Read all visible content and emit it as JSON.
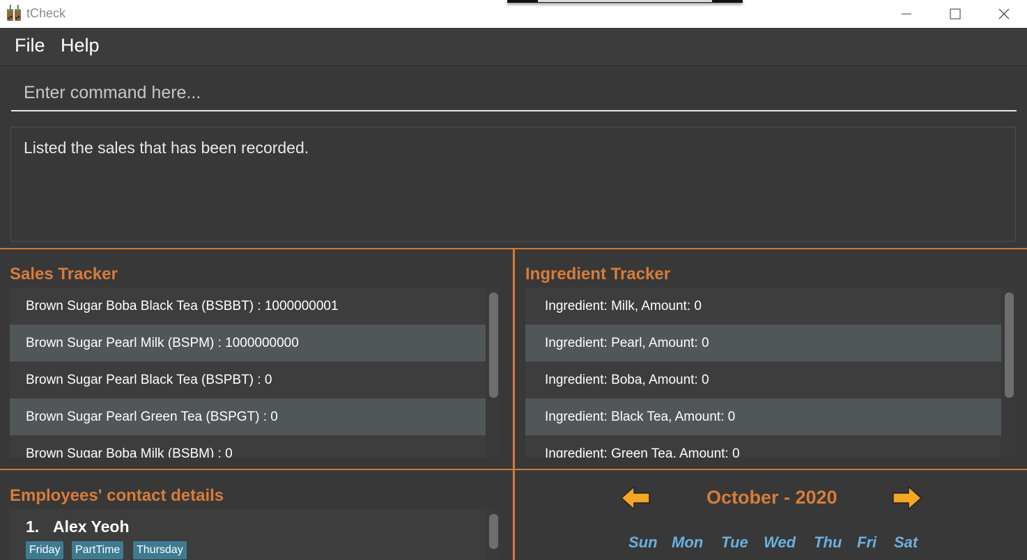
{
  "window": {
    "title": "tCheck"
  },
  "menu": {
    "file": "File",
    "help": "Help"
  },
  "command": {
    "placeholder": "Enter command here..."
  },
  "result": {
    "text": "Listed the sales that has been recorded."
  },
  "sales": {
    "title": "Sales Tracker",
    "items": [
      "Brown Sugar Boba Black Tea (BSBBT) : 1000000001",
      "Brown Sugar Pearl Milk (BSPM) : 1000000000",
      "Brown Sugar Pearl Black Tea (BSPBT) : 0",
      "Brown Sugar Pearl Green Tea (BSPGT) : 0",
      "Brown Sugar Boba Milk (BSBM) : 0"
    ]
  },
  "ingredients": {
    "title": "Ingredient Tracker",
    "items": [
      "Ingredient: Milk,  Amount: 0",
      "Ingredient: Pearl,  Amount: 0",
      "Ingredient: Boba,  Amount: 0",
      "Ingredient: Black Tea,  Amount: 0",
      "Ingredient: Green Tea,  Amount: 0"
    ]
  },
  "employees": {
    "title": "Employees' contact details",
    "items": [
      {
        "index": "1.",
        "name": "Alex Yeoh",
        "tags": [
          "Friday",
          "PartTime",
          "Thursday"
        ]
      }
    ]
  },
  "calendar": {
    "month": "October - 2020",
    "days": [
      "Sun",
      "Mon",
      "Tue",
      "Wed",
      "Thu",
      "Fri",
      "Sat"
    ]
  },
  "colors": {
    "accent": "#d87c3a",
    "tag": "#3e7b91",
    "arrow": "#f5a623",
    "day_header": "#6ab0e0"
  }
}
